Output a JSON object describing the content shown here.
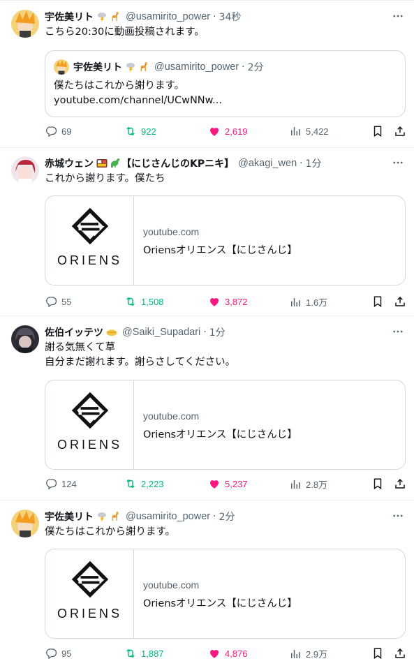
{
  "tweets": [
    {
      "name": "宇佐美リト",
      "handle": "@usamirito_power",
      "time": "34秒",
      "text": [
        "こちら20:30に動画投稿されます。"
      ],
      "quote": {
        "name": "宇佐美リト",
        "handle": "@usamirito_power",
        "time": "2分",
        "text": [
          "僕たちはこれから謝ります。",
          "youtube.com/channel/UCwNNw..."
        ]
      },
      "replies": "69",
      "retweets": "922",
      "likes": "2,619",
      "views": "5,422"
    },
    {
      "name": "赤城ウェン",
      "name_suffix": "【にじさんじのKPニキ】",
      "handle": "@akagi_wen",
      "time": "1分",
      "text": [
        "これから謝ります。僕たち"
      ],
      "card": {
        "domain": "youtube.com",
        "title": "Oriensオリエンス【にじさんじ】",
        "logo_text": "ORIENS"
      },
      "replies": "55",
      "retweets": "1,508",
      "likes": "3,872",
      "views": "1.6万"
    },
    {
      "name": "佐伯イッテツ",
      "handle": "@Saiki_Supadari",
      "time": "1分",
      "text": [
        "謝る気無くて草",
        "自分まだ謝れます。謝らさしてください。"
      ],
      "card": {
        "domain": "youtube.com",
        "title": "Oriensオリエンス【にじさんじ】",
        "logo_text": "ORIENS"
      },
      "replies": "124",
      "retweets": "2,223",
      "likes": "5,237",
      "views": "2.8万"
    },
    {
      "name": "宇佐美リト",
      "handle": "@usamirito_power",
      "time": "2分",
      "text": [
        "僕たちはこれから謝ります。"
      ],
      "card": {
        "domain": "youtube.com",
        "title": "Oriensオリエンス【にじさんじ】",
        "logo_text": "ORIENS"
      },
      "replies": "95",
      "retweets": "1,887",
      "likes": "4,876",
      "views": "2.9万"
    }
  ],
  "separator": "·",
  "colors": {
    "accent_like": "#f91880",
    "accent_retweet": "#00ba7c",
    "muted": "#536471",
    "border": "#cfd9de"
  },
  "icons": [
    "reply-icon",
    "retweet-icon",
    "like-icon",
    "views-icon",
    "bookmark-icon",
    "share-icon",
    "more-icon",
    "lightning-cloud-icon",
    "giraffe-icon",
    "bento-icon",
    "dinosaur-icon",
    "handshake-icon"
  ]
}
